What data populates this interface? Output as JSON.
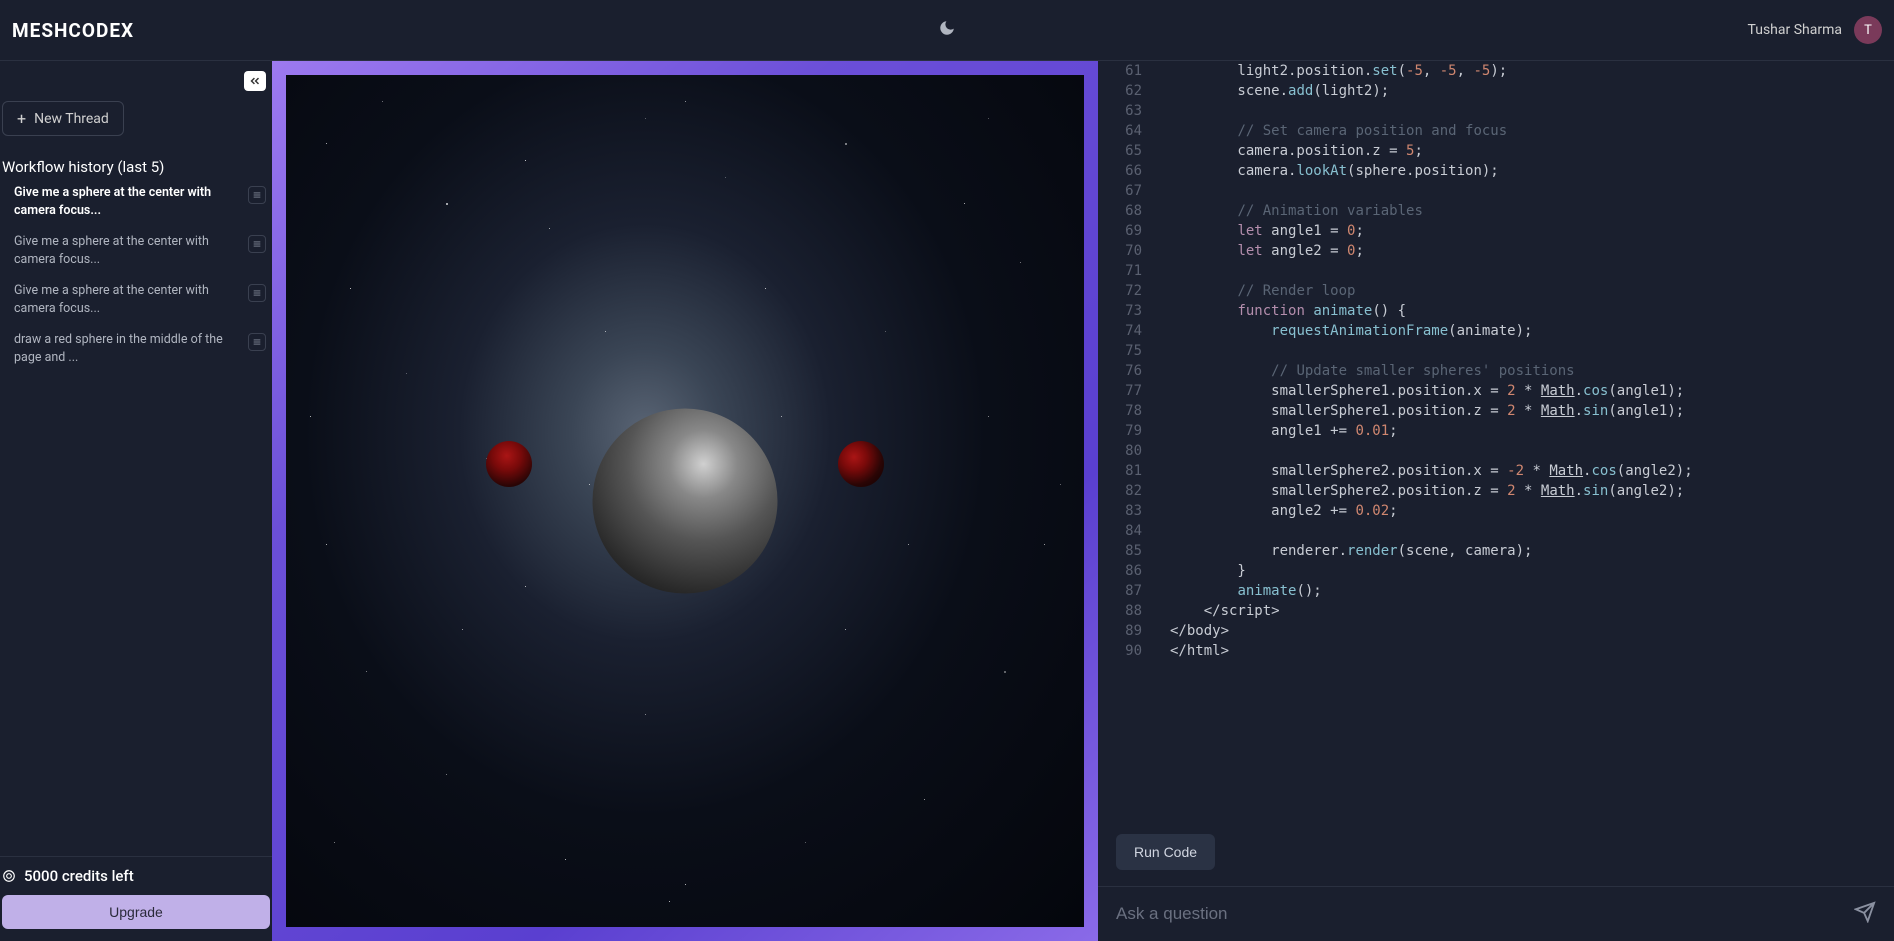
{
  "brand": "MESHCODEX",
  "user": {
    "name": "Tushar Sharma",
    "initial": "T"
  },
  "sidebar": {
    "new_thread_label": "New Thread",
    "history_title": "Workflow history (last 5)",
    "history": [
      {
        "text": "Give me a sphere at the center with camera focus...",
        "active": true
      },
      {
        "text": "Give me a sphere at the center with camera focus...",
        "active": false
      },
      {
        "text": "Give me a sphere at the center with camera focus...",
        "active": false
      },
      {
        "text": "draw a red sphere in the middle of the page and ...",
        "active": false
      }
    ],
    "credits_label": "5000 credits left",
    "upgrade_label": "Upgrade"
  },
  "code": {
    "lines": [
      {
        "n": 61,
        "html": "        light2.position.<span class='fn'>set</span>(<span class='num'>-5</span>, <span class='num'>-5</span>, <span class='num'>-5</span>);"
      },
      {
        "n": 62,
        "html": "        scene.<span class='fn'>add</span>(light2);"
      },
      {
        "n": 63,
        "html": ""
      },
      {
        "n": 64,
        "html": "        <span class='com'>// Set camera position and focus</span>"
      },
      {
        "n": 65,
        "html": "        camera.position.z = <span class='num'>5</span>;"
      },
      {
        "n": 66,
        "html": "        camera.<span class='fn'>lookAt</span>(sphere.position);"
      },
      {
        "n": 67,
        "html": ""
      },
      {
        "n": 68,
        "html": "        <span class='com'>// Animation variables</span>"
      },
      {
        "n": 69,
        "html": "        <span class='kw'>let</span> angle1 = <span class='num'>0</span>;"
      },
      {
        "n": 70,
        "html": "        <span class='kw'>let</span> angle2 = <span class='num'>0</span>;"
      },
      {
        "n": 71,
        "html": ""
      },
      {
        "n": 72,
        "html": "        <span class='com'>// Render loop</span>"
      },
      {
        "n": 73,
        "html": "        <span class='kw'>function</span> <span class='fn'>animate</span>() {"
      },
      {
        "n": 74,
        "html": "            <span class='fn'>requestAnimationFrame</span>(animate);"
      },
      {
        "n": 75,
        "html": ""
      },
      {
        "n": 76,
        "html": "            <span class='com'>// Update smaller spheres' positions</span>"
      },
      {
        "n": 77,
        "html": "            smallerSphere1.position.x = <span class='num'>2</span> * <span class='ident'>Math</span>.<span class='fn'>cos</span>(angle1);"
      },
      {
        "n": 78,
        "html": "            smallerSphere1.position.z = <span class='num'>2</span> * <span class='ident'>Math</span>.<span class='fn'>sin</span>(angle1);"
      },
      {
        "n": 79,
        "html": "            angle1 += <span class='num'>0.01</span>;"
      },
      {
        "n": 80,
        "html": ""
      },
      {
        "n": 81,
        "html": "            smallerSphere2.position.x = <span class='num'>-2</span> * <span class='ident'>Math</span>.<span class='fn'>cos</span>(angle2);"
      },
      {
        "n": 82,
        "html": "            smallerSphere2.position.z = <span class='num'>2</span> * <span class='ident'>Math</span>.<span class='fn'>sin</span>(angle2);"
      },
      {
        "n": 83,
        "html": "            angle2 += <span class='num'>0.02</span>;"
      },
      {
        "n": 84,
        "html": ""
      },
      {
        "n": 85,
        "html": "            renderer.<span class='fn'>render</span>(scene, camera);"
      },
      {
        "n": 86,
        "html": "        }"
      },
      {
        "n": 87,
        "html": "        <span class='fn'>animate</span>();"
      },
      {
        "n": 88,
        "html": "    &lt;/script&gt;"
      },
      {
        "n": 89,
        "html": "&lt;/body&gt;"
      },
      {
        "n": 90,
        "html": "&lt;/html&gt;"
      }
    ],
    "run_label": "Run Code"
  },
  "input": {
    "placeholder": "Ask a question"
  }
}
